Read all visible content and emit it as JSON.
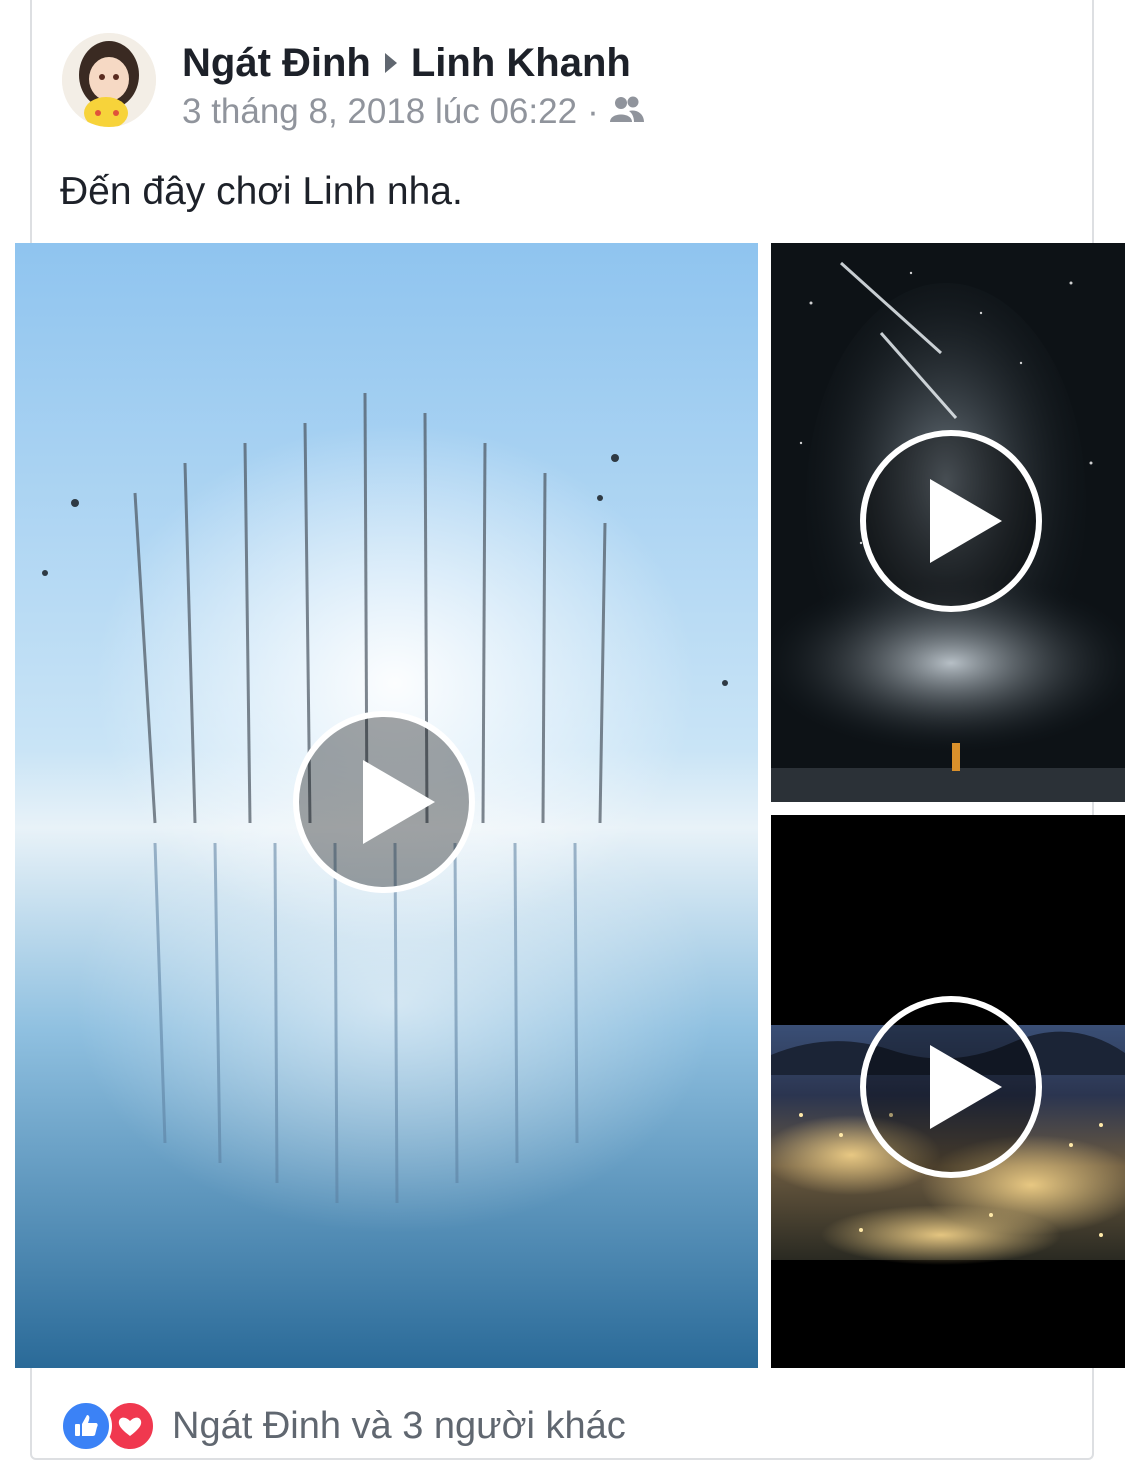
{
  "post": {
    "author": "Ngát Đinh",
    "target": "Linh Khanh",
    "timestamp": "3 tháng 8, 2018 lúc 06:22",
    "separator": "·",
    "privacy_icon": "friends-icon",
    "text": "Đến đây chơi Linh nha."
  },
  "media": [
    {
      "type": "video",
      "scene": "frozen-trees-lake",
      "icon": "play-icon"
    },
    {
      "type": "video",
      "scene": "starry-night-sky",
      "icon": "play-icon"
    },
    {
      "type": "video",
      "scene": "city-lights-night",
      "icon": "play-icon"
    }
  ],
  "reactions": {
    "icons": [
      "like-icon",
      "love-icon"
    ],
    "summary": "Ngát Đinh và 3 người khác"
  },
  "colors": {
    "name_text": "#1d2129",
    "meta_text": "#90949c",
    "like_blue": "#3b82f6",
    "love_red": "#f0384f"
  }
}
